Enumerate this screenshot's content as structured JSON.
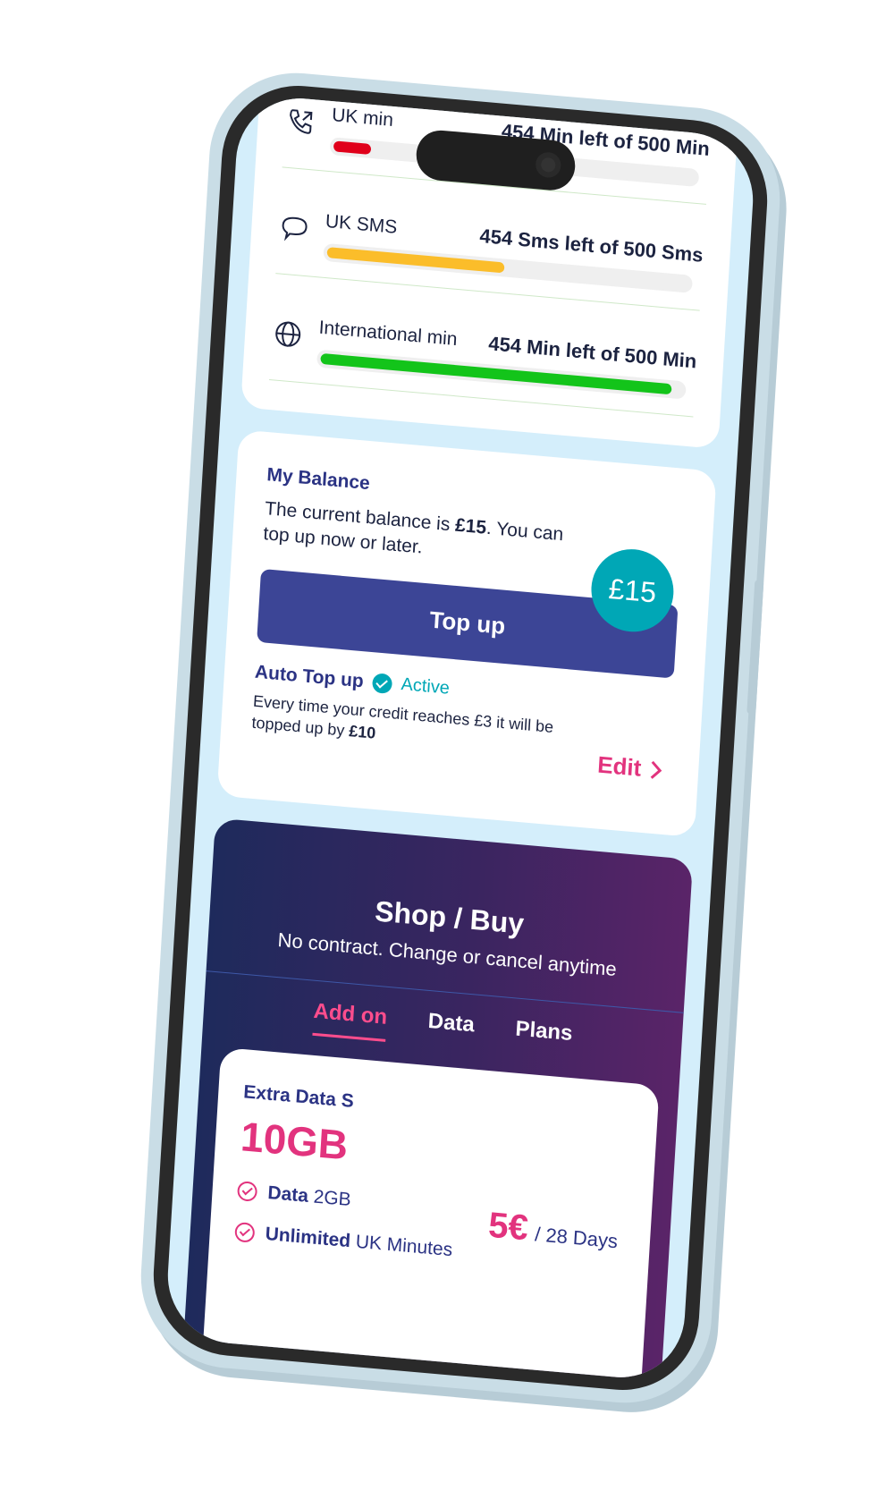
{
  "usage": [
    {
      "label": "UK min",
      "left": "454 Min left of 500 Min",
      "icon": "phone-icon",
      "color": "#e0001a",
      "progress": 0.12
    },
    {
      "label": "UK SMS",
      "left": "454 Sms left of 500 Sms",
      "icon": "chat-icon",
      "color": "#fbbd2a",
      "progress": 0.5
    },
    {
      "label": "International min",
      "left": "454 Min left of 500 Min",
      "icon": "globe-icon",
      "color": "#13c41a",
      "progress": 0.97
    }
  ],
  "balance": {
    "title": "My Balance",
    "text_prefix": "The current balance is ",
    "amount": "£15",
    "text_suffix": ". You can top up now or later.",
    "circle": "£15",
    "button": "Top up",
    "auto_title": "Auto Top up",
    "auto_status": "Active",
    "auto_desc_prefix": "Every time your credit reaches £3 it will be topped up by ",
    "auto_desc_amount": "£10",
    "edit": "Edit"
  },
  "shop": {
    "title": "Shop / Buy",
    "subtitle": "No contract. Change or cancel anytime",
    "tabs": [
      "Add on",
      "Data",
      "Plans"
    ],
    "offer": {
      "name": "Extra Data S",
      "size": "10GB",
      "price": "5€",
      "period": "/ 28 Days",
      "features": [
        {
          "bold": "Data",
          "rest": "2GB"
        },
        {
          "bold": "Unlimited",
          "rest": "UK Minutes"
        }
      ]
    }
  },
  "colors": {
    "accent": "#e2337e",
    "primary": "#3c4596",
    "teal": "#00a7b6"
  }
}
